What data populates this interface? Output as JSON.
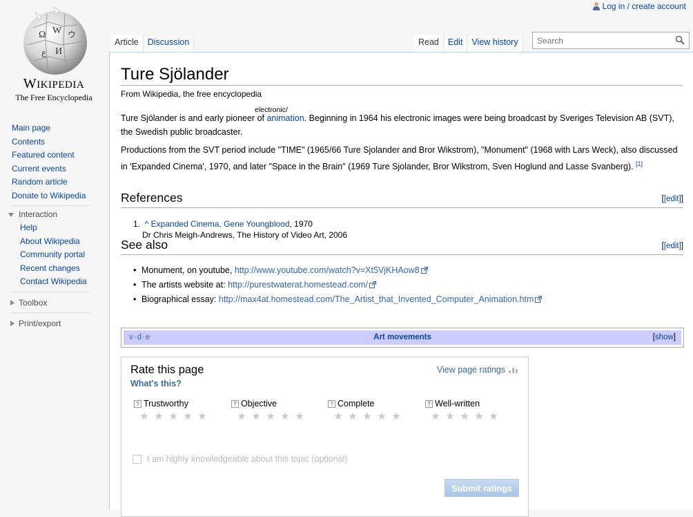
{
  "logo": {
    "wordmark_first": "W",
    "wordmark_rest": "IKIPEDIA",
    "tagline": "The Free Encyclopedia"
  },
  "header": {
    "login_link": "Log in / create account",
    "tabs_left": [
      "Article",
      "Discussion"
    ],
    "tabs_right": [
      "Read",
      "Edit",
      "View history"
    ],
    "search_placeholder": "Search"
  },
  "sidebar": {
    "nav": [
      "Main page",
      "Contents",
      "Featured content",
      "Current events",
      "Random article",
      "Donate to Wikipedia"
    ],
    "interaction_label": "Interaction",
    "interaction_items": [
      "Help",
      "About Wikipedia",
      "Community portal",
      "Recent changes",
      "Contact Wikipedia"
    ],
    "toolbox_label": "Toolbox",
    "print_label": "Print/export"
  },
  "article": {
    "title": "Ture Sjölander",
    "tagline": "From Wikipedia, the free encyclopedia",
    "annotation": "electronic/",
    "p1_pre": "Ture Sjölander is and early pioneer of ",
    "p1_link": "animation",
    "p1_post": ". Beginning in 1964 his electronic images were being broadcast by Sveriges Television AB (SVT), the Swedish public broadcaster.",
    "p2": "Productions from the SVT period include \"TIME\" (1965/66 Ture Sjolander and Bror Wikstrom), \"Monument\" (1968 with Lars Weck), also discussed in 'Expanded Cinema', 1970, and later \"Space in the Brain\" (1969 Ture Sjolander, Bror Wikstrom, Sven Hoglund and Lasse Svanberg).",
    "p2_ref": "[1]",
    "references_heading": "References",
    "see_also_heading": "See also",
    "edit_label": "[edit]",
    "ref_number": "1.",
    "ref_caret": "^",
    "ref_link": "Expanded Cinema, Gene Youngblood",
    "ref_year": ", 1970",
    "ref_line2": "Dr Chris  Meigh-Andrews, The History of Video Art, 2006",
    "see_also": [
      {
        "text": "Monument, on youtube, ",
        "url": "http://www.youtube.com/watch?v=Xt5VjKHAow8"
      },
      {
        "text": "The artists website at: ",
        "url": "http://purestwaterat.homestead.com/"
      },
      {
        "text": "Biographical essay: ",
        "url": "http://max4at.homestead.com/The_Artist_that_Invented_Computer_Animation.htm"
      }
    ]
  },
  "navbox": {
    "vde": "v·d·e",
    "title": "Art movements",
    "show": "show"
  },
  "rating": {
    "title": "Rate this page",
    "whats_this": "What's this?",
    "view_ratings": "View page ratings",
    "criteria": [
      "Trustworthy",
      "Objective",
      "Complete",
      "Well-written"
    ],
    "help_glyph": "?",
    "knowledge_label": "I am highly knowledgeable about this topic (optional)",
    "submit_label": "Submit ratings"
  }
}
